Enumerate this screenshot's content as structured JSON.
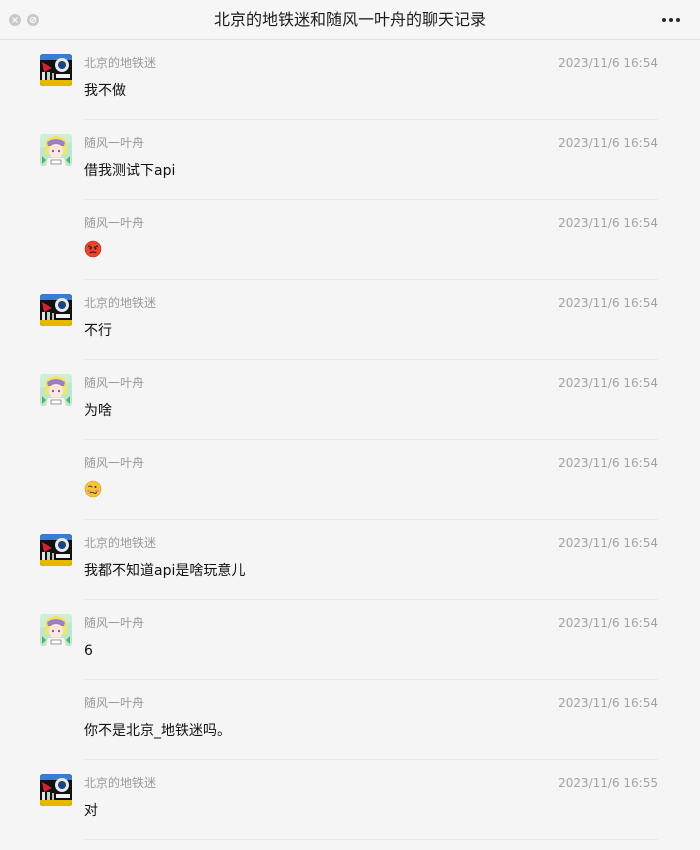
{
  "window": {
    "title": "北京的地铁迷和随风一叶舟的聊天记录"
  },
  "messages": [
    {
      "sender": "北京的地铁迷",
      "time": "2023/11/6 16:54",
      "text": "我不做",
      "avatar": "metro"
    },
    {
      "sender": "随风一叶舟",
      "time": "2023/11/6 16:54",
      "text": "借我测试下api",
      "avatar": "zhou"
    },
    {
      "sender": "随风一叶舟",
      "time": "2023/11/6 16:54",
      "text": "",
      "emoji": "angry-face-emoji",
      "avatar": ""
    },
    {
      "sender": "北京的地铁迷",
      "time": "2023/11/6 16:54",
      "text": "不行",
      "avatar": "metro"
    },
    {
      "sender": "随风一叶舟",
      "time": "2023/11/6 16:54",
      "text": "为啥",
      "avatar": "zhou"
    },
    {
      "sender": "随风一叶舟",
      "time": "2023/11/6 16:54",
      "text": "",
      "emoji": "woozy-face-emoji",
      "avatar": ""
    },
    {
      "sender": "北京的地铁迷",
      "time": "2023/11/6 16:54",
      "text": "我都不知道api是啥玩意儿",
      "avatar": "metro"
    },
    {
      "sender": "随风一叶舟",
      "time": "2023/11/6 16:54",
      "text": "6",
      "avatar": "zhou"
    },
    {
      "sender": "随风一叶舟",
      "time": "2023/11/6 16:54",
      "text": "你不是北京_地铁迷吗。",
      "avatar": ""
    },
    {
      "sender": "北京的地铁迷",
      "time": "2023/11/6 16:55",
      "text": "对",
      "avatar": "metro"
    }
  ],
  "icons": {
    "close": "close-icon",
    "minimize": "minimize-icon",
    "more": "more-icon"
  },
  "colors": {
    "background": "#f5f5f5",
    "meta_text": "#9a9a9a",
    "divider": "#e9e9e9"
  }
}
